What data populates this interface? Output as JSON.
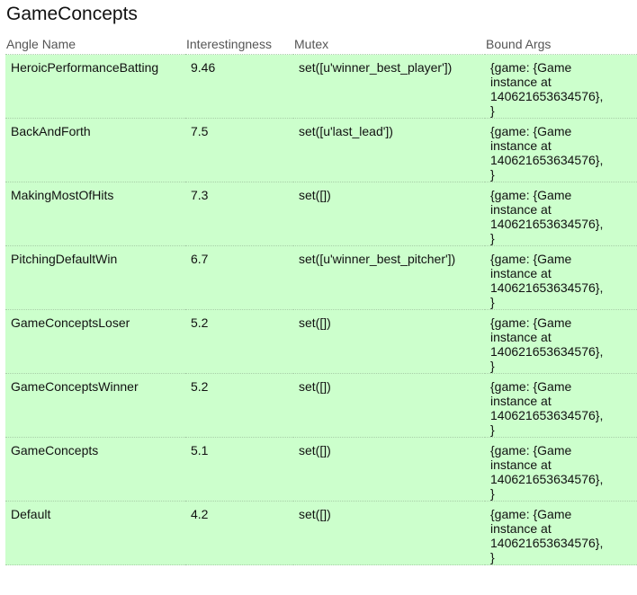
{
  "page": {
    "title": "GameConcepts"
  },
  "table": {
    "headers": {
      "angle_name": "Angle Name",
      "interestingness": "Interestingness",
      "mutex": "Mutex",
      "bound_args": "Bound Args"
    },
    "rows": [
      {
        "angle_name": "HeroicPerformanceBatting",
        "interestingness": "9.46",
        "mutex": "set([u'winner_best_player'])",
        "bound_args": [
          "{game: {Game",
          "instance at",
          "140621653634576},",
          "}"
        ]
      },
      {
        "angle_name": "BackAndForth",
        "interestingness": "7.5",
        "mutex": "set([u'last_lead'])",
        "bound_args": [
          "{game: {Game",
          "instance at",
          "140621653634576},",
          "}"
        ]
      },
      {
        "angle_name": "MakingMostOfHits",
        "interestingness": "7.3",
        "mutex": "set([])",
        "bound_args": [
          "{game: {Game",
          "instance at",
          "140621653634576},",
          "}"
        ]
      },
      {
        "angle_name": "PitchingDefaultWin",
        "interestingness": "6.7",
        "mutex": "set([u'winner_best_pitcher'])",
        "bound_args": [
          "{game: {Game",
          "instance at",
          "140621653634576},",
          "}"
        ]
      },
      {
        "angle_name": "GameConceptsLoser",
        "interestingness": "5.2",
        "mutex": "set([])",
        "bound_args": [
          "{game: {Game",
          "instance at",
          "140621653634576},",
          "}"
        ]
      },
      {
        "angle_name": "GameConceptsWinner",
        "interestingness": "5.2",
        "mutex": "set([])",
        "bound_args": [
          "{game: {Game",
          "instance at",
          "140621653634576},",
          "}"
        ]
      },
      {
        "angle_name": "GameConcepts",
        "interestingness": "5.1",
        "mutex": "set([])",
        "bound_args": [
          "{game: {Game",
          "instance at",
          "140621653634576},",
          "}"
        ]
      },
      {
        "angle_name": "Default",
        "interestingness": "4.2",
        "mutex": "set([])",
        "bound_args": [
          "{game: {Game",
          "instance at",
          "140621653634576},",
          "}"
        ]
      }
    ]
  },
  "colors": {
    "row_background": "#ccffcc",
    "row_separator": "#a8cfa8",
    "header_text": "#555555"
  }
}
